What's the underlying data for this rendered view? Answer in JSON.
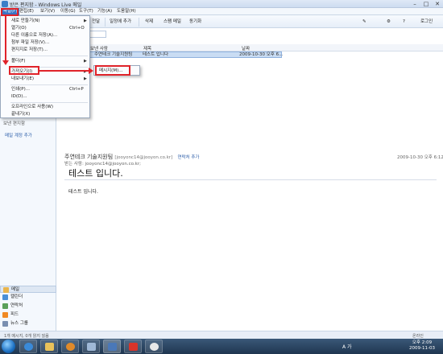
{
  "window": {
    "title": "받은 편지함 - Windows Live 메일",
    "controls": [
      "–",
      "□",
      "✕"
    ]
  },
  "menubar": {
    "items": [
      "파일(F)",
      "편집(E)",
      "보기(V)",
      "이동(G)",
      "도구(T)",
      "기능(A)",
      "도움말(H)"
    ]
  },
  "toolbar": {
    "buttons": [
      "전달",
      "일정에 추가",
      "삭제",
      "스팸 메일",
      "동기화"
    ],
    "login": "로그인"
  },
  "file_menu": {
    "items": [
      {
        "label": "새로 만들기(N)",
        "shortcut": "",
        "submenu": true
      },
      {
        "label": "열기(O)",
        "shortcut": "Ctrl+O",
        "submenu": false
      },
      {
        "label": "다른 이름으로 저장(A)...",
        "shortcut": "",
        "submenu": false
      },
      {
        "label": "첨부 파일 저장(V)...",
        "shortcut": "",
        "submenu": false
      },
      {
        "label": "편지지로 저장(T)...",
        "shortcut": "",
        "submenu": false
      },
      {
        "label": "폴더(F)",
        "shortcut": "",
        "submenu": true
      },
      {
        "label": "가져오기(I)",
        "shortcut": "",
        "submenu": true
      },
      {
        "label": "내보내기(E)",
        "shortcut": "",
        "submenu": true
      },
      {
        "label": "인쇄(P)...",
        "shortcut": "Ctrl+P",
        "submenu": false
      },
      {
        "label": "ID(D)...",
        "shortcut": "",
        "submenu": false
      },
      {
        "label": "오프라인으로 사용(W)",
        "shortcut": "",
        "submenu": false
      },
      {
        "label": "끝내기(X)",
        "shortcut": "",
        "submenu": false
      }
    ],
    "import_submenu": [
      "메시지(M)..."
    ]
  },
  "sidebar": {
    "folder_stub": "보낸 편지함",
    "add_account": "메일 계정 추가",
    "nav": [
      {
        "label": "메일",
        "icon": "mail-icon",
        "color": "#e9b44c"
      },
      {
        "label": "캘린더",
        "icon": "calendar-icon",
        "color": "#4a8fd6"
      },
      {
        "label": "연락처",
        "icon": "contacts-icon",
        "color": "#5aa05a"
      },
      {
        "label": "피드",
        "icon": "feed-icon",
        "color": "#f08a24"
      },
      {
        "label": "뉴스 그룹",
        "icon": "newsgroup-icon",
        "color": "#7a8fb0"
      }
    ]
  },
  "message_list": {
    "columns": [
      "보낸 사람",
      "제목",
      "날짜"
    ],
    "rows": [
      {
        "from": "주연테크 기술지원팀",
        "subject": "테스트 입니다",
        "date": "2009-10-30 오후 6..."
      }
    ]
  },
  "preview": {
    "from_name": "주연테크 기술지원팀",
    "from_email": "[jooyonc14@jooyon.co.kr]",
    "add_contact": "연락처 추가",
    "date": "2009-10-30 오후 6:12",
    "to_label": "받는 사람:",
    "to_value": "jooyonc14@jooyon.co.kr;",
    "subject": "테스트 입니다.",
    "body": "테스트 입니다."
  },
  "statusbar": {
    "text": "1개 메시지, 0개 읽지 않음",
    "right": "온라인"
  },
  "taskbar": {
    "tray_text": "A 가",
    "time": "오후 2:09",
    "date": "2009-11-03"
  },
  "colors": {
    "highlight": "#e0232a",
    "menu_active": "#3a74c4"
  }
}
